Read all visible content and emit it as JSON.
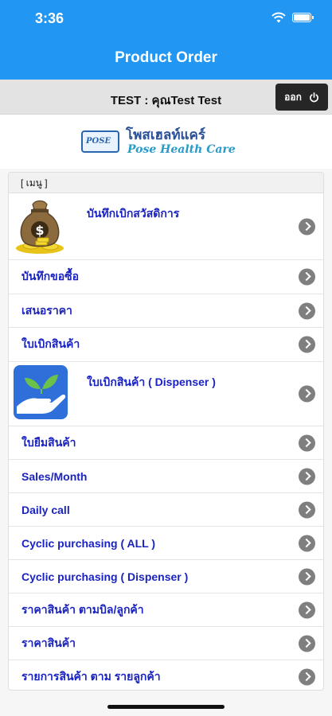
{
  "status": {
    "time": "3:36",
    "wifi_icon": "wifi-icon",
    "battery_icon": "battery-icon"
  },
  "nav": {
    "title": "Product Order"
  },
  "user_bar": {
    "text": "TEST : คุณTest Test",
    "logout_label": "ออก",
    "logout_icon": "power-icon"
  },
  "logo": {
    "badge": "POSE",
    "name_th": "โพสเฮลท์แคร์",
    "name_en": "Pose Health Care"
  },
  "menu": {
    "header": "[ เมนู ]",
    "items": [
      {
        "label": "บันทึกเบิกสวัสดิการ",
        "icon": "money-bag-icon"
      },
      {
        "label": "บันทึกขอซื้อ"
      },
      {
        "label": "เสนอราคา"
      },
      {
        "label": "ใบเบิกสินค้า"
      },
      {
        "label": "ใบเบิกสินค้า ( Dispenser )",
        "icon": "hand-plant-icon"
      },
      {
        "label": "ใบยืมสินค้า"
      },
      {
        "label": "Sales/Month"
      },
      {
        "label": "Daily call"
      },
      {
        "label": "Cyclic purchasing ( ALL )"
      },
      {
        "label": "Cyclic purchasing ( Dispenser )"
      },
      {
        "label": "ราคาสินค้า ตามบิล/ลูกค้า"
      },
      {
        "label": "ราคาสินค้า"
      },
      {
        "label": "รายการสินค้า ตาม รายลูกค้า"
      }
    ]
  },
  "colors": {
    "primary": "#2196f3",
    "link": "#1a23bf",
    "chevron": "#7f7f7f"
  }
}
